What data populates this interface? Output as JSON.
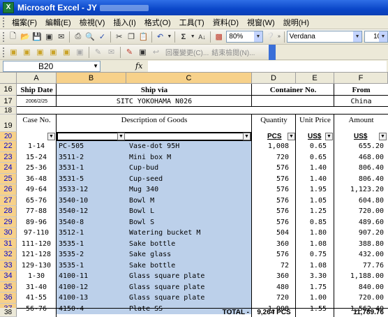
{
  "window": {
    "title": "Microsoft Excel - JY"
  },
  "menu": [
    "檔案(F)",
    "編輯(E)",
    "檢視(V)",
    "插入(I)",
    "格式(O)",
    "工具(T)",
    "資料(D)",
    "視窗(W)",
    "說明(H)"
  ],
  "toolbar": {
    "zoom": "80%",
    "font": "Verdana",
    "font_size": "10",
    "reply_label": "回覆變更(C)...",
    "end_review_label": "結束檢閱(N)..."
  },
  "formula_bar": {
    "name_box": "B20",
    "fx": "fx",
    "formula": ""
  },
  "columns": [
    "A",
    "B",
    "C",
    "D",
    "E",
    "F"
  ],
  "header_rows": {
    "r16": {
      "num": "16",
      "ship_date": "Ship Date",
      "ship_via": "Ship via",
      "container": "Container No.",
      "from": "From"
    },
    "r17": {
      "num": "17",
      "date": "2006/2/25",
      "via": "SITC YOKOHAMA N026",
      "from": "China"
    },
    "r18": {
      "num": "18"
    },
    "r19": {
      "num": "19",
      "case": "Case No.",
      "desc": "Description of Goods",
      "qty": "Quantity",
      "price": "Unit Price",
      "amount": "Amount"
    },
    "r20": {
      "num": "20",
      "pcs": "PCS",
      "usd1": "US$",
      "usd2": "US$"
    }
  },
  "items": [
    {
      "row": "22",
      "case": "1-14",
      "code": "PC-505",
      "desc": "Vase-dot 95H",
      "qty": "1,008",
      "price": "0.65",
      "amount": "655.20"
    },
    {
      "row": "23",
      "case": "15-24",
      "code": "3511-2",
      "desc": "Mini box M",
      "qty": "720",
      "price": "0.65",
      "amount": "468.00"
    },
    {
      "row": "24",
      "case": "25-36",
      "code": "3531-1",
      "desc": "Cup-bud",
      "qty": "576",
      "price": "1.40",
      "amount": "806.40"
    },
    {
      "row": "25",
      "case": "36-48",
      "code": "3531-5",
      "desc": "Cup-seed",
      "qty": "576",
      "price": "1.40",
      "amount": "806.40"
    },
    {
      "row": "26",
      "case": "49-64",
      "code": "3533-12",
      "desc": "Mug 340",
      "qty": "576",
      "price": "1.95",
      "amount": "1,123.20"
    },
    {
      "row": "27",
      "case": "65-76",
      "code": "3540-10",
      "desc": "Bowl M",
      "qty": "576",
      "price": "1.05",
      "amount": "604.80"
    },
    {
      "row": "28",
      "case": "77-88",
      "code": "3540-12",
      "desc": "Bowl L",
      "qty": "576",
      "price": "1.25",
      "amount": "720.00"
    },
    {
      "row": "29",
      "case": "89-96",
      "code": "3540-8",
      "desc": "Bowl S",
      "qty": "576",
      "price": "0.85",
      "amount": "489.60"
    },
    {
      "row": "30",
      "case": "97-110",
      "code": "3512-1",
      "desc": "Watering bucket M",
      "qty": "504",
      "price": "1.80",
      "amount": "907.20"
    },
    {
      "row": "31",
      "case": "111-120",
      "code": "3535-1",
      "desc": "Sake bottle",
      "qty": "360",
      "price": "1.08",
      "amount": "388.80"
    },
    {
      "row": "32",
      "case": "121-128",
      "code": "3535-2",
      "desc": "Sake glass",
      "qty": "576",
      "price": "0.75",
      "amount": "432.00"
    },
    {
      "row": "33",
      "case": "129-130",
      "code": "3535-1",
      "desc": "Sake bottle",
      "qty": "72",
      "price": "1.08",
      "amount": "77.76"
    },
    {
      "row": "34",
      "case": "1-30",
      "code": "4100-11",
      "desc": "Glass square plate",
      "qty": "360",
      "price": "3.30",
      "amount": "1,188.00"
    },
    {
      "row": "35",
      "case": "31-40",
      "code": "4100-12",
      "desc": "Glass square plate",
      "qty": "480",
      "price": "1.75",
      "amount": "840.00"
    },
    {
      "row": "36",
      "case": "41-55",
      "code": "4100-13",
      "desc": "Glass square plate",
      "qty": "720",
      "price": "1.00",
      "amount": "720.00"
    },
    {
      "row": "37",
      "case": "56-76",
      "code": "4150-4",
      "desc": "Plate SS",
      "qty": "1,008",
      "price": "1.55",
      "amount": "1,562.40"
    }
  ],
  "total_row": {
    "row": "38",
    "label": "TOTAL -",
    "qty": "9,264 PCS",
    "amount": "11,789.76"
  }
}
